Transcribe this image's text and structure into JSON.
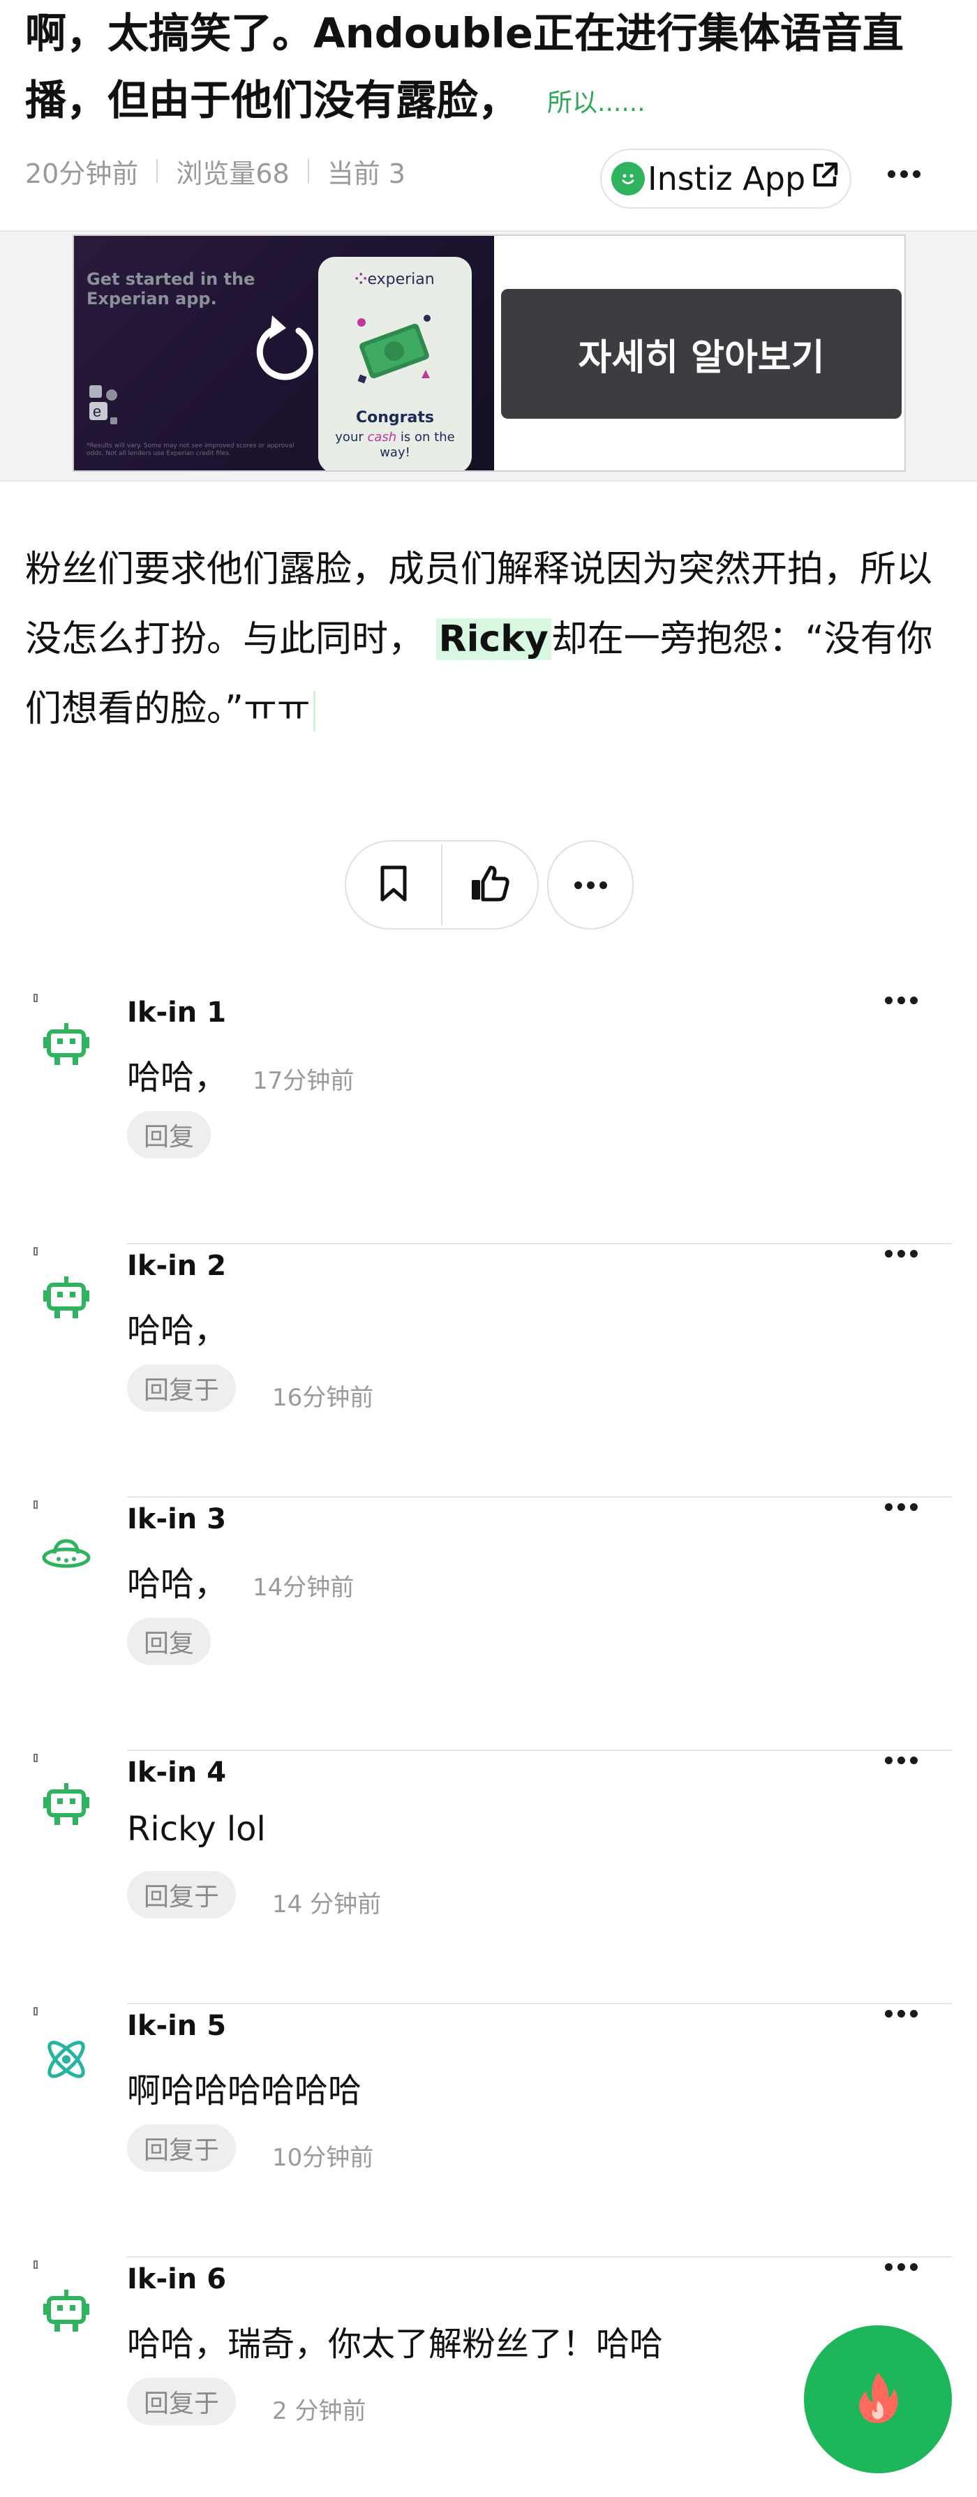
{
  "post": {
    "title": "啊，太搞笑了。Andouble正在进行集体语音直播，但由于他们没有露脸，",
    "more_link": "所以......",
    "time": "20分钟前",
    "views": "浏览量68",
    "current": "当前 3",
    "app_button": "Instiz App",
    "body_part1": "粉丝们要求他们露脸，成员们解释说因为突然开拍，所以没怎么打扮。与此同时，",
    "body_highlight": "Ricky",
    "body_part2": "却在一旁抱怨：“没有你们想看的脸。”ㅠㅠ"
  },
  "ad": {
    "tagline": "Get started in the Experian app.",
    "fineprint": "*Results will vary. Some may not see improved scores or approval odds. Not all lenders use Experian credit files.",
    "brand": "experian",
    "congrats": "Congrats",
    "sub_before": "your ",
    "sub_em": "cash",
    "sub_after": " is on the way!",
    "cta": "자세히 알아보기"
  },
  "actions": {
    "bookmark_icon": "bookmark-icon",
    "like_icon": "thumbs-up-icon",
    "more_icon": "more-icon"
  },
  "comments": [
    {
      "name": "Ik-in 1",
      "text": "哈哈，",
      "inline_time": "17分钟前",
      "reply": "回复",
      "reply_time": "",
      "avatar": "robot-icon"
    },
    {
      "name": "Ik-in 2",
      "text": "哈哈，",
      "inline_time": "",
      "reply": "回复于",
      "reply_time": "16分钟前",
      "avatar": "robot-icon"
    },
    {
      "name": "Ik-in 3",
      "text": "哈哈，",
      "inline_time": "14分钟前",
      "reply": "回复",
      "reply_time": "",
      "avatar": "ufo-icon"
    },
    {
      "name": "Ik-in 4",
      "text": "Ricky lol",
      "inline_time": "",
      "reply": "回复于",
      "reply_time": "14 分钟前",
      "avatar": "robot-icon"
    },
    {
      "name": "Ik-in 5",
      "text": "啊哈哈哈哈哈哈",
      "inline_time": "",
      "reply": "回复于",
      "reply_time": "10分钟前",
      "avatar": "atom-icon"
    },
    {
      "name": "Ik-in 6",
      "text": "哈哈，瑞奇，你太了解粉丝了！哈哈",
      "inline_time": "",
      "reply": "回复于",
      "reply_time": "2 分钟前",
      "avatar": "robot-icon"
    }
  ],
  "colors": {
    "accent_green": "#2fb35f",
    "highlight_bg": "#d8f8e2",
    "ad_button": "#3b3d40"
  }
}
